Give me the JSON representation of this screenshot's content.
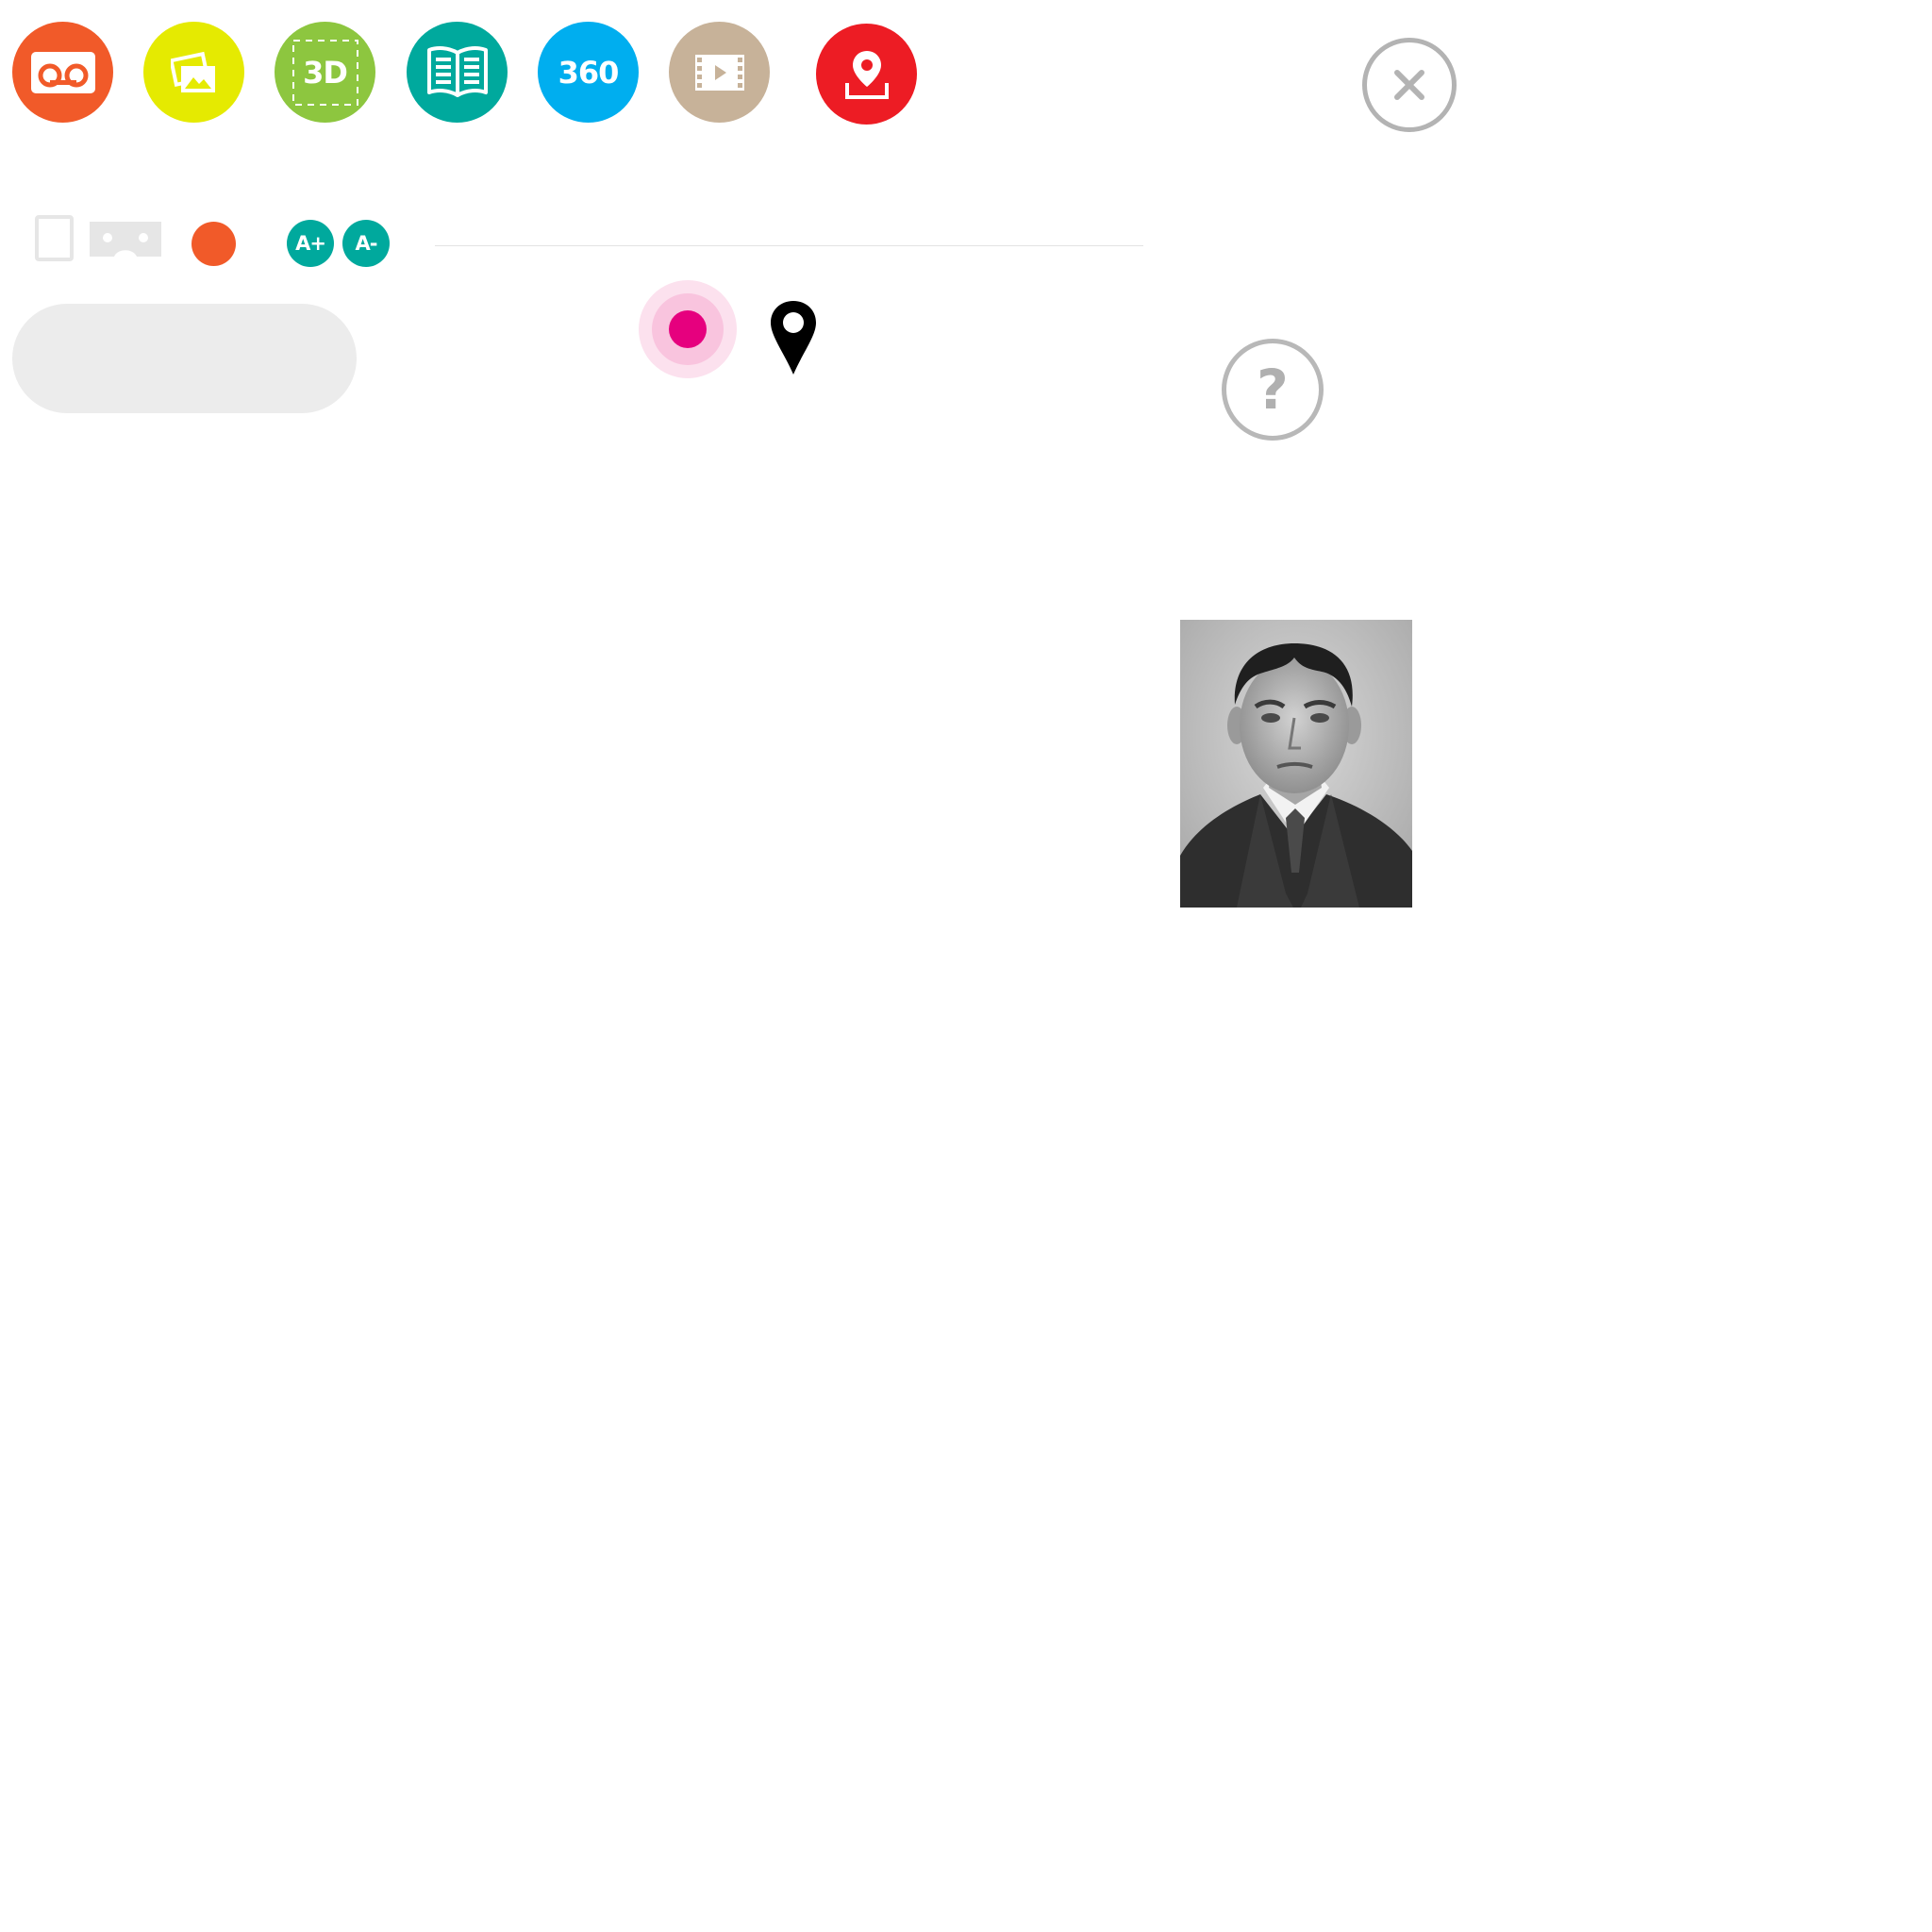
{
  "toolbar": {
    "buttons": [
      {
        "name": "audio",
        "icon": "voicemail-tape-icon",
        "color": "#f15a29"
      },
      {
        "name": "gallery",
        "icon": "photo-gallery-icon",
        "color": "#e5ea01"
      },
      {
        "name": "3d",
        "icon": "3d-icon",
        "label": "3D",
        "color": "#8dc63f"
      },
      {
        "name": "book",
        "icon": "open-book-icon",
        "color": "#00a99d"
      },
      {
        "name": "360",
        "icon": "360-icon",
        "label": "360",
        "color": "#00aeef"
      },
      {
        "name": "video",
        "icon": "film-play-icon",
        "color": "#c7b299"
      },
      {
        "name": "location",
        "icon": "map-location-icon",
        "color": "#ed1c24"
      }
    ],
    "close_icon": "close-icon"
  },
  "controls": {
    "tablet_icon": "tablet-icon",
    "vr_icon": "vr-headset-icon",
    "record_dot_color": "#f15a29",
    "font_increase_label": "A+",
    "font_decrease_label": "A-"
  },
  "map": {
    "current_location_color": "#e6007e",
    "pin_icon": "map-pin-icon"
  },
  "help": {
    "label": "?"
  },
  "portrait": {
    "alt": "portrait-photo"
  }
}
